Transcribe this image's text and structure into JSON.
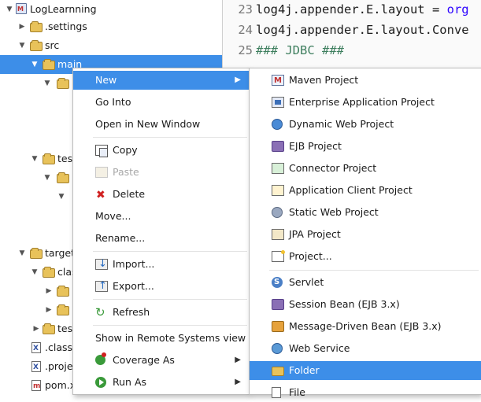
{
  "tree": {
    "items": [
      {
        "label": "LogLearnning",
        "arrow": "▼",
        "icon": "project-icon"
      },
      {
        "label": ".settings",
        "arrow": "▶",
        "icon": "folder-icon"
      },
      {
        "label": "src",
        "arrow": "▼",
        "icon": "folder-icon"
      },
      {
        "label": "main",
        "arrow": "▼",
        "icon": "folder-icon"
      },
      {
        "label": "test",
        "arrow": "▼",
        "icon": "folder-icon"
      },
      {
        "label": "target",
        "arrow": "▼",
        "icon": "folder-icon"
      },
      {
        "label": "clas",
        "arrow": "▼",
        "icon": "folder-icon"
      },
      {
        "label": "test",
        "arrow": "▶",
        "icon": "folder-icon"
      },
      {
        "label": ".classp",
        "arrow": "",
        "icon": "file-icon"
      },
      {
        "label": ".projec",
        "arrow": "",
        "icon": "file-icon"
      },
      {
        "label": "pom.xr",
        "arrow": "",
        "icon": "file-icon"
      }
    ]
  },
  "editor": {
    "lines": [
      {
        "num": "23",
        "code": "log4j.appender.E.layout = ",
        "value": "org"
      },
      {
        "num": "24",
        "code": "log4j.appender.E.layout.Conve",
        "value": ""
      },
      {
        "num": "25",
        "code": "",
        "comment": " ### JDBC ###"
      }
    ]
  },
  "context_menu": {
    "new": "New",
    "go_into": "Go Into",
    "open_new_window": "Open in New Window",
    "copy": "Copy",
    "paste": "Paste",
    "delete": "Delete",
    "move": "Move...",
    "rename": "Rename...",
    "import": "Import...",
    "export": "Export...",
    "refresh": "Refresh",
    "remote_systems": "Show in Remote Systems view",
    "coverage_as": "Coverage As",
    "run_as": "Run As",
    "submenu_arrow": "▶"
  },
  "submenu": {
    "maven_project": "Maven Project",
    "enterprise_app": "Enterprise Application Project",
    "dynamic_web": "Dynamic Web Project",
    "ejb_project": "EJB Project",
    "connector_project": "Connector Project",
    "app_client": "Application Client Project",
    "static_web": "Static Web Project",
    "jpa_project": "JPA Project",
    "project": "Project...",
    "servlet": "Servlet",
    "session_bean": "Session Bean (EJB 3.x)",
    "mdb": "Message-Driven Bean (EJB 3.x)",
    "web_service": "Web Service",
    "folder": "Folder",
    "file": "File"
  },
  "colors": {
    "selection": "#3d8ee8",
    "folder": "#e8c25a",
    "code_value": "#2a00ff",
    "code_comment": "#3f7f5f"
  }
}
